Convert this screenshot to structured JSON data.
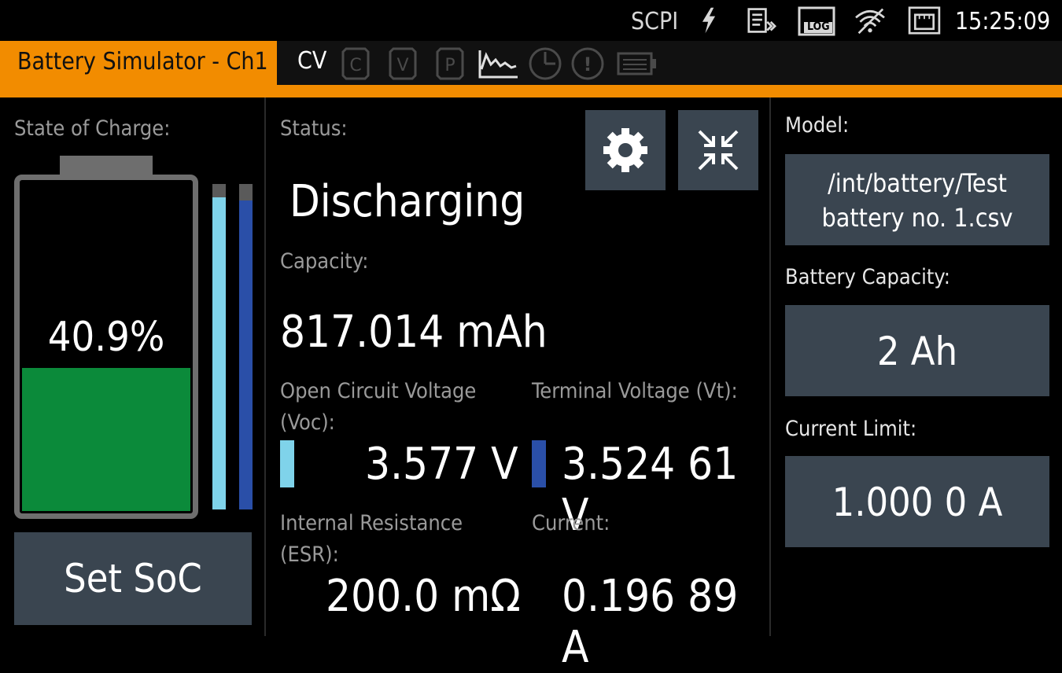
{
  "status_bar": {
    "protocol": "SCPI",
    "time": "15:25:09",
    "icons": [
      "lightning-icon",
      "remote-icon",
      "log-icon",
      "wifi-icon",
      "lan-icon"
    ],
    "log_text": "LOG"
  },
  "tab": {
    "title": "Battery Simulator - Ch1",
    "mode": "CV",
    "indicators": [
      {
        "name": "c-indicator",
        "text": "C"
      },
      {
        "name": "v-indicator",
        "text": "V"
      },
      {
        "name": "p-indicator",
        "text": "P"
      },
      {
        "name": "waveform-indicator",
        "text": ""
      },
      {
        "name": "timer-indicator",
        "text": ""
      },
      {
        "name": "warning-indicator",
        "text": "!"
      },
      {
        "name": "battery-indicator",
        "text": ""
      }
    ]
  },
  "soc": {
    "label": "State of Charge:",
    "percent_text": "40.9%",
    "fill_fraction": 0.409,
    "bar1_fraction": 0.96,
    "bar2_fraction": 0.95,
    "set_button": "Set SoC"
  },
  "status": {
    "label": "Status:",
    "value": "Discharging",
    "capacity_label": "Capacity:",
    "capacity_value": "817.014 mAh",
    "voc_label_1": "Open Circuit Voltage",
    "voc_label_2": "(Voc):",
    "voc_value": "3.577 V",
    "vt_label": "Terminal Voltage (Vt):",
    "vt_value": "3.524 61 V",
    "esr_label_1": "Internal Resistance",
    "esr_label_2": "(ESR):",
    "esr_value": "200.0 mΩ",
    "current_label": "Current:",
    "current_value": "0.196 89 A"
  },
  "right": {
    "model_label": "Model:",
    "model_line1": "/int/battery/Test",
    "model_line2": "battery no. 1.csv",
    "capacity_label": "Battery Capacity:",
    "capacity_value": "2 Ah",
    "current_limit_label": "Current Limit:",
    "current_limit_value": "1.000 0 A"
  },
  "colors": {
    "accent": "#f28c00",
    "soc_fill": "#0b8a3a",
    "voc_bar": "#7fd3ea",
    "vt_bar": "#2a4fa8",
    "button": "#3a4550"
  }
}
